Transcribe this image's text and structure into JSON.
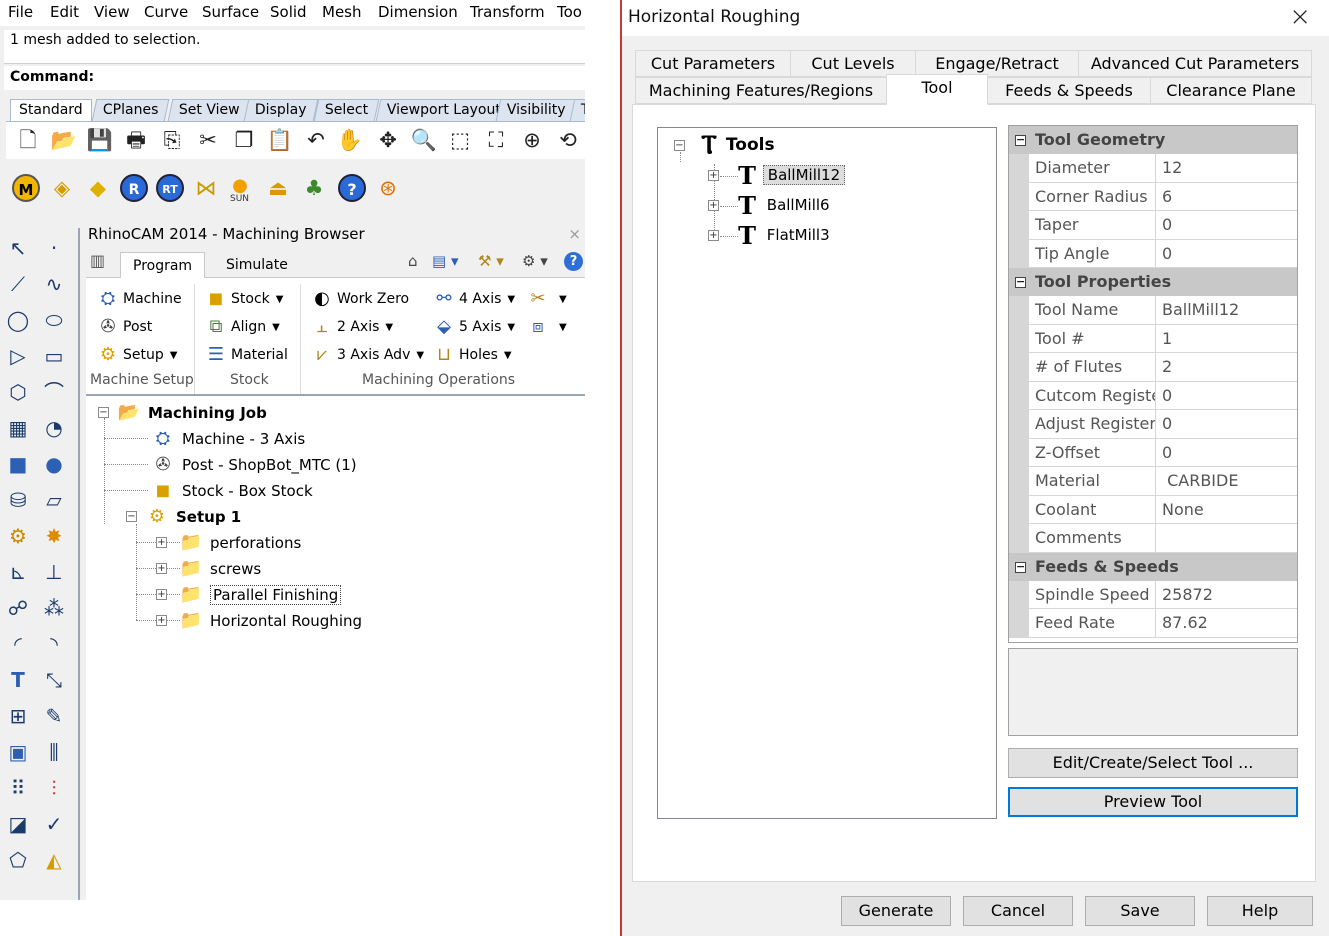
{
  "menu": [
    "File",
    "Edit",
    "View",
    "Curve",
    "Surface",
    "Solid",
    "Mesh",
    "Dimension",
    "Transform",
    "Too"
  ],
  "command_history": "1 mesh added to selection.",
  "command_prompt": "Command:",
  "toolbar_tabs": [
    "Standard",
    "CPlanes",
    "Set View",
    "Display",
    "Select",
    "Viewport Layout",
    "Visibility",
    "T"
  ],
  "toolbar_icons_row1": [
    "new-file-icon",
    "open-folder-icon",
    "save-icon",
    "print-icon",
    "copy-to-clipboard-icon",
    "cut-icon",
    "copy-icon",
    "paste-icon",
    "undo-icon",
    "pan-hand-icon",
    "rotate-view-icon",
    "zoom-icon",
    "zoom-window-icon",
    "zoom-extents-icon",
    "zoom-selected-icon",
    "rotate-icon"
  ],
  "toolbar_icons_row2": [
    "rhinocam-machining-icon",
    "tag-icon",
    "tag-yellow-icon",
    "r-icon",
    "rt-icon",
    "grid-icon",
    "sun-icon",
    "layer-icon",
    "tree-icon",
    "help-icon",
    "target-icon"
  ],
  "toolbar_sun_label": "SUN",
  "sidebar_icons": [
    "select-arrow-icon",
    "point-icon",
    "polyline-icon",
    "curve-icon",
    "circle-icon",
    "ellipse-icon",
    "polygon-icon",
    "rectangle-icon",
    "hexagon-icon",
    "arc-icon",
    "surface-icon",
    "sweep-icon",
    "box-icon",
    "sphere-icon",
    "cylinder-icon",
    "plane-icon",
    "gear-icon",
    "explode-icon",
    "extrude-icon",
    "trim-icon",
    "boolean-icon",
    "dots-icon",
    "fillet-icon",
    "offset-icon",
    "text-icon",
    "scale-icon",
    "array-icon",
    "edit-icon",
    "mesh-box-icon",
    "dims-icon",
    "grid-array-icon",
    "ruler-icon",
    "cube-icon",
    "check-icon",
    "transform-icon",
    "paint-icon"
  ],
  "browser": {
    "title": "RhinoCAM 2014 - Machining Browser",
    "close": "×",
    "tabs": [
      "Program",
      "Simulate"
    ],
    "groups": {
      "machine_setup": {
        "label": "Machine Setup",
        "items": [
          "Machine",
          "Post",
          "Setup"
        ]
      },
      "stock": {
        "label": "Stock",
        "items": [
          "Stock",
          "Align",
          "Material"
        ]
      },
      "operations": {
        "label": "Machining Operations",
        "items": [
          "Work Zero",
          "2 Axis",
          "3 Axis Adv",
          "4 Axis",
          "5 Axis",
          "Holes"
        ]
      }
    },
    "tree": {
      "root": "Machining Job",
      "machine": "Machine - 3 Axis",
      "post": "Post - ShopBot_MTC (1)",
      "stock": "Stock - Box Stock",
      "setup": "Setup 1",
      "folders": [
        "perforations",
        "screws",
        "Parallel Finishing",
        "Horizontal Roughing"
      ]
    }
  },
  "dialog": {
    "title": "Horizontal Roughing",
    "close": "×",
    "tabs_row1": [
      "Cut Parameters",
      "Cut Levels",
      "Engage/Retract",
      "Advanced Cut Parameters"
    ],
    "tabs_row2": [
      "Machining Features/Regions",
      "Tool",
      "Feeds & Speeds",
      "Clearance Plane"
    ],
    "active_tab": "Tool",
    "tool_tree": {
      "root": "Tools",
      "items": [
        "BallMill12",
        "BallMill6",
        "FlatMill3"
      ],
      "selected": "BallMill12"
    },
    "properties": {
      "geometry": {
        "label": "Tool Geometry",
        "rows": [
          [
            "Diameter",
            "12"
          ],
          [
            "Corner Radius",
            "6"
          ],
          [
            "Taper",
            "0"
          ],
          [
            "Tip Angle",
            "0"
          ]
        ]
      },
      "tool_props": {
        "label": "Tool Properties",
        "rows": [
          [
            "Tool Name",
            "BallMill12"
          ],
          [
            "Tool #",
            "1"
          ],
          [
            "# of Flutes",
            "2"
          ],
          [
            "Cutcom Registe",
            "0"
          ],
          [
            "Adjust Register",
            "0"
          ],
          [
            "Z-Offset",
            "0"
          ],
          [
            "Material",
            " CARBIDE"
          ],
          [
            "Coolant",
            "None"
          ],
          [
            "Comments",
            ""
          ]
        ]
      },
      "feeds": {
        "label": "Feeds & Speeds",
        "rows": [
          [
            "Spindle Speed",
            "25872"
          ],
          [
            "Feed Rate",
            "87.62"
          ]
        ]
      }
    },
    "edit_tool_button": "Edit/Create/Select Tool ...",
    "preview_tool_button": "Preview Tool",
    "footer_buttons": [
      "Generate",
      "Cancel",
      "Save",
      "Help"
    ]
  }
}
